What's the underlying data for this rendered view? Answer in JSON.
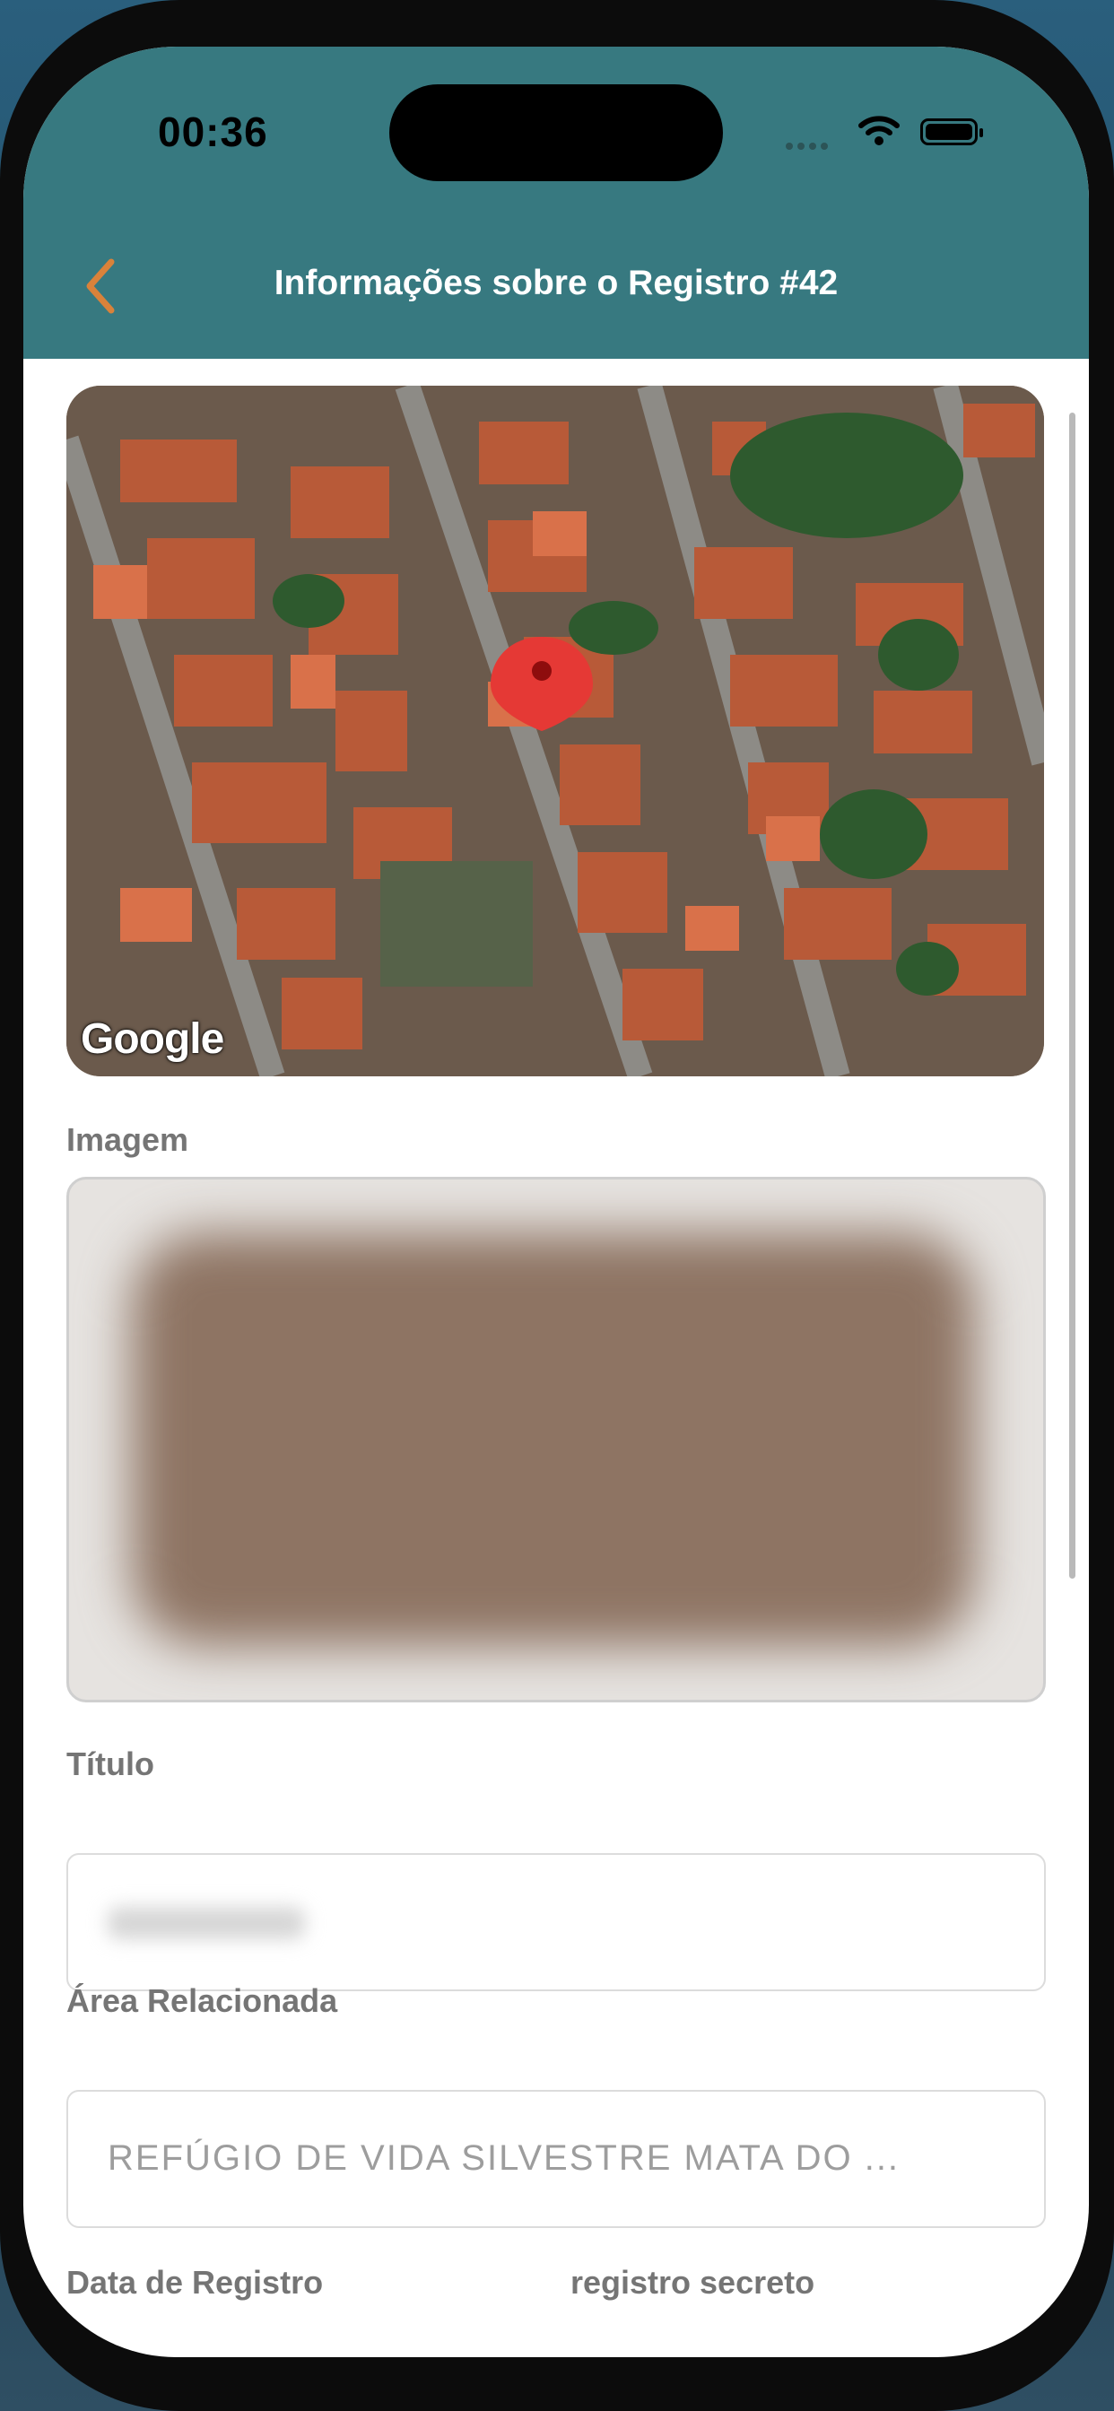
{
  "status_bar": {
    "time": "00:36"
  },
  "header": {
    "title": "Informações sobre o Registro #42"
  },
  "map": {
    "attribution": "Google"
  },
  "form": {
    "image_label": "Imagem",
    "title_label": "Título",
    "title_value": "",
    "area_label": "Área Relacionada",
    "area_value": "REFÚGIO DE VIDA SILVESTRE MATA DO ...",
    "date_label": "Data de Registro",
    "secret_label": "registro secreto"
  },
  "colors": {
    "header": "#377980",
    "back_chevron": "#d9823a",
    "label": "#757575",
    "pin": "#e53935"
  },
  "icons": [
    "back-chevron-icon",
    "wifi-icon",
    "battery-icon",
    "map-pin-icon"
  ]
}
